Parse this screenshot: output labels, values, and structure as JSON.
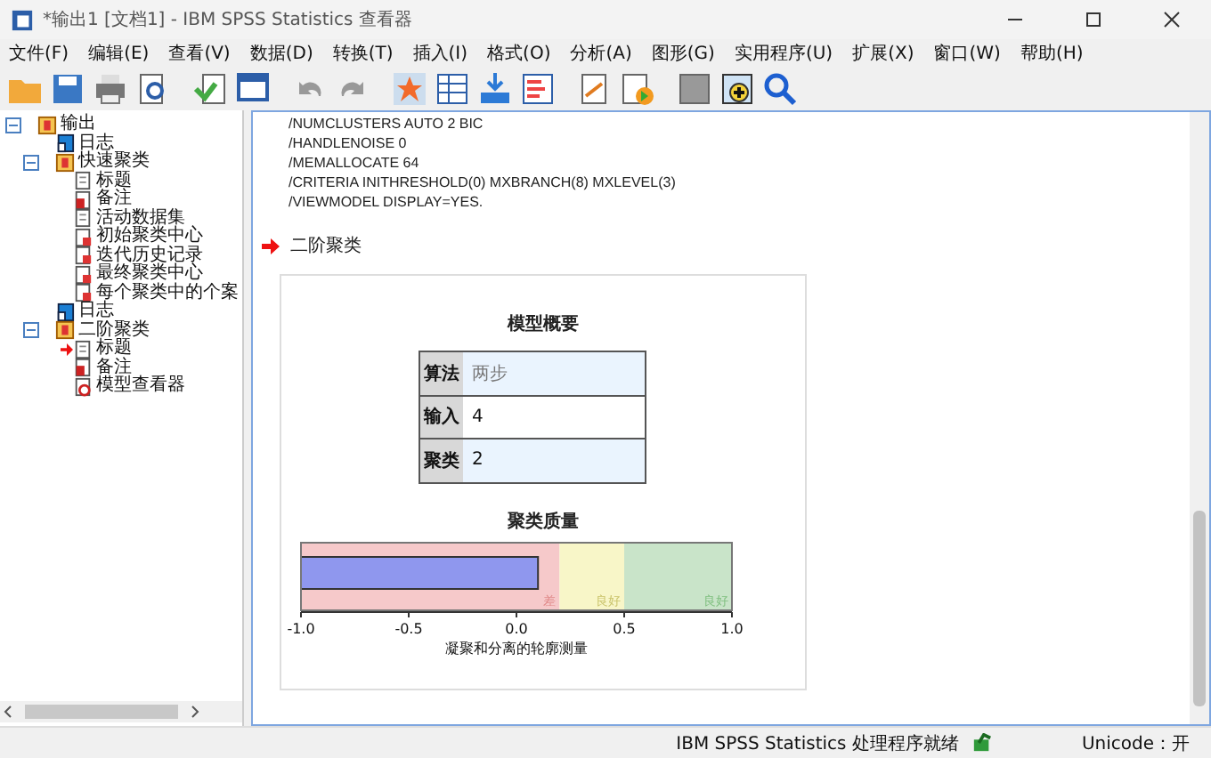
{
  "window": {
    "title": "*输出1 [文档1] - IBM SPSS Statistics 查看器"
  },
  "menu": [
    "文件(F)",
    "编辑(E)",
    "查看(V)",
    "数据(D)",
    "转换(T)",
    "插入(I)",
    "格式(O)",
    "分析(A)",
    "图形(G)",
    "实用程序(U)",
    "扩展(X)",
    "窗口(W)",
    "帮助(H)"
  ],
  "tree": [
    {
      "label": "输出",
      "kind": "folder",
      "expanded": true,
      "current": false,
      "children": [
        {
          "label": "日志",
          "kind": "log",
          "current": false
        },
        {
          "label": "快速聚类",
          "kind": "folder",
          "expanded": true,
          "current": false,
          "children": [
            {
              "label": "标题",
              "kind": "title",
              "current": false
            },
            {
              "label": "备注",
              "kind": "notes",
              "current": false
            },
            {
              "label": "活动数据集",
              "kind": "title",
              "current": false
            },
            {
              "label": "初始聚类中心",
              "kind": "table",
              "current": false
            },
            {
              "label": "迭代历史记录",
              "kind": "table",
              "current": false
            },
            {
              "label": "最终聚类中心",
              "kind": "table",
              "current": false
            },
            {
              "label": "每个聚类中的个案",
              "kind": "table",
              "current": false
            }
          ]
        },
        {
          "label": "日志",
          "kind": "log",
          "current": false
        },
        {
          "label": "二阶聚类",
          "kind": "folder",
          "expanded": true,
          "current": false,
          "children": [
            {
              "label": "标题",
              "kind": "title",
              "current": true
            },
            {
              "label": "备注",
              "kind": "notes",
              "current": false
            },
            {
              "label": "模型查看器",
              "kind": "model",
              "current": false
            }
          ]
        }
      ]
    }
  ],
  "syntax": [
    "/NUMCLUSTERS AUTO 2 BIC",
    "/HANDLENOISE 0",
    "/MEMALLOCATE 64",
    "/CRITERIA INITHRESHOLD(0) MXBRANCH(8) MXLEVEL(3)",
    "/VIEWMODEL DISPLAY=YES."
  ],
  "section_heading": "二阶聚类",
  "model_summary": {
    "title": "模型概要",
    "rows": [
      {
        "label": "算法",
        "value": "两步",
        "shaded": true
      },
      {
        "label": "输入",
        "value": "4",
        "shaded": false
      },
      {
        "label": "聚类",
        "value": "2",
        "shaded": true
      }
    ]
  },
  "cluster_quality": {
    "title": "聚类质量",
    "scale_caption": "凝聚和分离的轮廓测量",
    "level": 0.55,
    "scale_labels": [
      "-1.0",
      "-0.5",
      "0.0",
      "0.5",
      "1.0"
    ],
    "bands": [
      {
        "label": "差",
        "color": "#f6c9ca"
      },
      {
        "label": "良好",
        "color": "#f8f6c8"
      },
      {
        "label": "良好",
        "color": "#c9e4c9"
      }
    ]
  },
  "status_bar": {
    "message": "IBM SPSS Statistics 处理程序就绪",
    "encoding": "Unicode：开"
  }
}
